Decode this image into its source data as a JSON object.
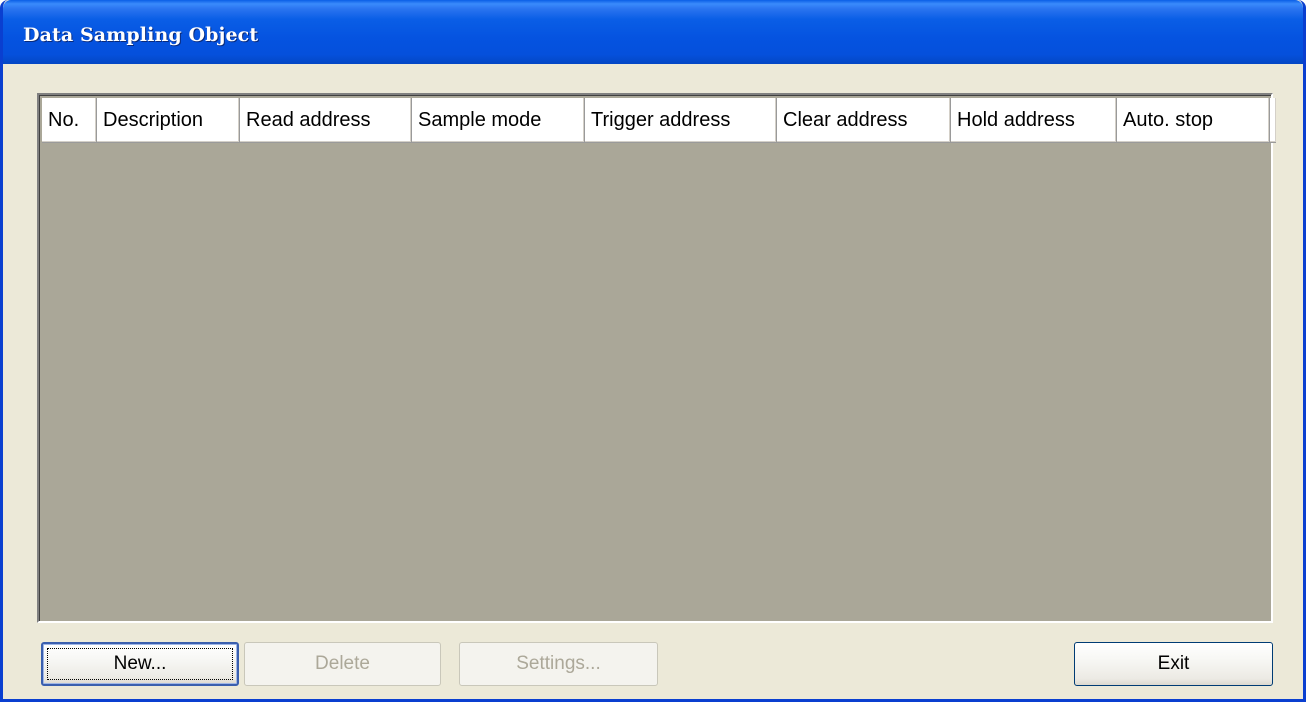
{
  "window": {
    "title": "Data Sampling Object"
  },
  "table": {
    "columns": [
      "No.",
      "Description",
      "Read address",
      "Sample mode",
      "Trigger address",
      "Clear address",
      "Hold address",
      "Auto. stop"
    ],
    "rows": []
  },
  "buttons": {
    "new_label": "New...",
    "delete_label": "Delete",
    "settings_label": "Settings...",
    "exit_label": "Exit"
  },
  "colors": {
    "titlebar": "#0553e0",
    "client_background": "#ece9d8",
    "list_background": "#aaa798"
  }
}
